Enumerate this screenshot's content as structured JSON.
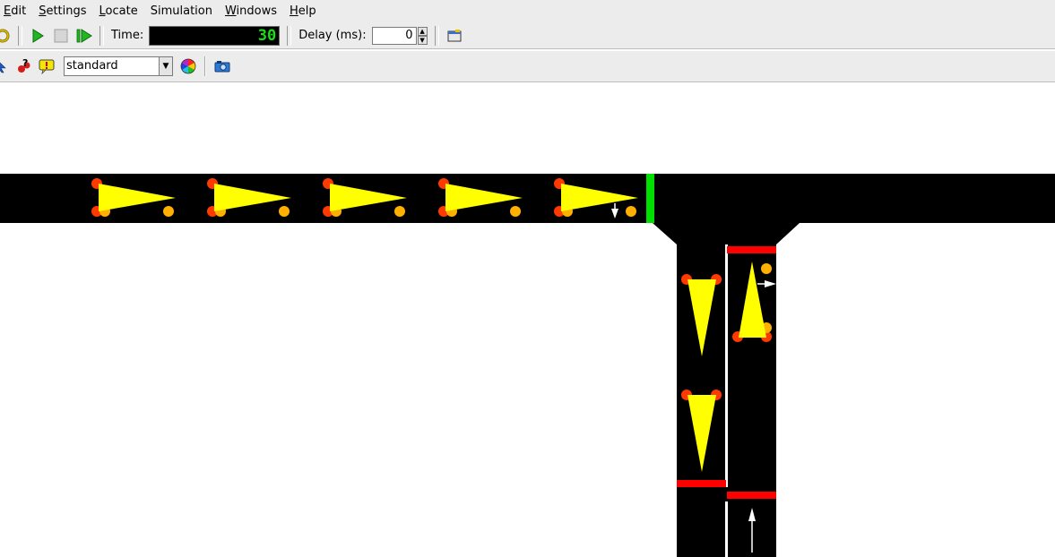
{
  "menu": {
    "items": [
      {
        "label": "Edit",
        "mnemonic": "E",
        "rest": "dit"
      },
      {
        "label": "Settings",
        "mnemonic": "S",
        "rest": "ettings"
      },
      {
        "label": "Locate",
        "mnemonic": "L",
        "rest": "ocate"
      },
      {
        "label": "Simulation",
        "mnemonic": "",
        "rest": "Simulation"
      },
      {
        "label": "Windows",
        "mnemonic": "W",
        "rest": "indows"
      },
      {
        "label": "Help",
        "mnemonic": "H",
        "rest": "elp"
      }
    ]
  },
  "toolbar": {
    "time_label": "Time:",
    "time_value": "30",
    "delay_label": "Delay (ms):",
    "delay_value": "0",
    "scheme_value": "standard",
    "icons": [
      "reload-icon",
      "play-icon",
      "stop-icon",
      "step-icon",
      "open-window-icon",
      "select-icon",
      "locate-icon",
      "tooltip-icon",
      "color-wheel-icon",
      "camera-icon"
    ]
  },
  "simulation": {
    "road_color": "#000000",
    "vehicle_color": "#ffff00",
    "signal_green": "#00e000",
    "signal_red": "#ff0000",
    "wheel_color": "#ff3a00",
    "light_color": "#ffb000"
  }
}
